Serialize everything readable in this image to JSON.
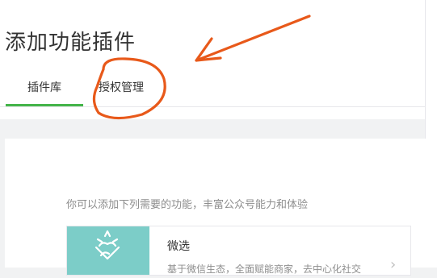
{
  "page": {
    "title": "添加功能插件"
  },
  "tabs": [
    {
      "label": "插件库",
      "active": true
    },
    {
      "label": "授权管理",
      "active": false
    }
  ],
  "content": {
    "intro": "你可以添加下列需要的功能，丰富公众号能力和体验",
    "plugins": [
      {
        "name": "微选",
        "description": "基于微信生态，全面赋能商家，去中心化社交",
        "icon": "gift-heart-icon",
        "icon_bg": "#7ccdc8"
      }
    ]
  },
  "colors": {
    "accent": "#44b549",
    "annotation": "#e8591a"
  }
}
